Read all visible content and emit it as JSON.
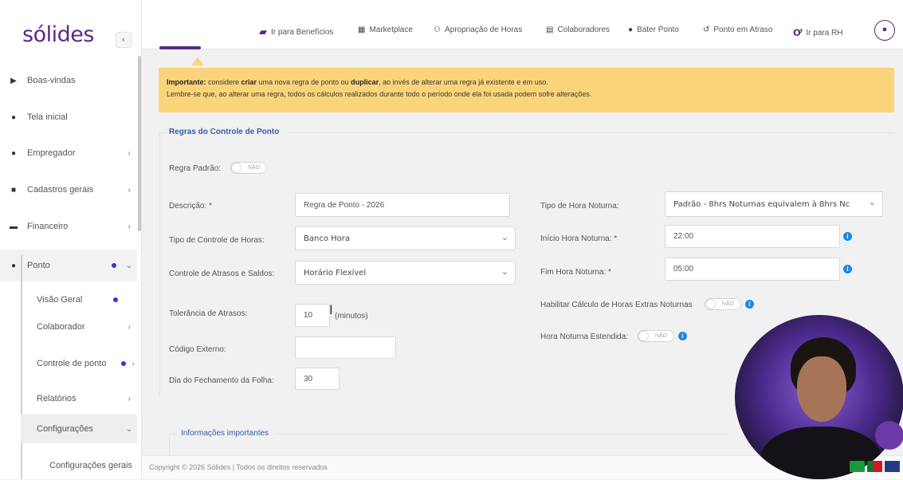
{
  "brand": {
    "logo": "sólides",
    "collapse_icon": "chevron-left-icon"
  },
  "sidebar": {
    "items": [
      {
        "label": "Boas-vindas",
        "icon": "play-icon",
        "glyph": "▶"
      },
      {
        "label": "Tela inicial",
        "icon": "info-icon",
        "glyph": "●"
      },
      {
        "label": "Empregador",
        "icon": "user-circle-icon",
        "glyph": "●",
        "chevron": "›"
      },
      {
        "label": "Cadastros gerais",
        "icon": "plus-square-icon",
        "glyph": "■",
        "chevron": "›"
      },
      {
        "label": "Financeiro",
        "icon": "money-icon",
        "glyph": "▬",
        "chevron": "›"
      },
      {
        "label": "Ponto",
        "icon": "clock-icon",
        "glyph": "●",
        "chevron": "⌄"
      }
    ],
    "sub_items": [
      {
        "label": "Visão Geral"
      },
      {
        "label": "Colaborador",
        "chevron": "›"
      },
      {
        "label": "Controle de ponto",
        "chevron": "›"
      },
      {
        "label": "Relatórios",
        "chevron": "›"
      },
      {
        "label": "Configurações",
        "chevron": "⌄"
      },
      {
        "label": "Configurações gerais"
      }
    ]
  },
  "topbar": {
    "items": [
      {
        "label": "Ir para Benefícios",
        "icon": "megaphone-icon",
        "glyph": "▰"
      },
      {
        "label": "Marketplace",
        "icon": "cart-icon",
        "glyph": "▦"
      },
      {
        "label": "Apropriação de Horas",
        "icon": "users-icon",
        "glyph": "⚇"
      },
      {
        "label": "Colaboradores",
        "icon": "id-card-icon",
        "glyph": "▤"
      },
      {
        "label": "Bater Ponto",
        "icon": "clock-icon",
        "glyph": "●"
      },
      {
        "label": "Ponto em Atraso",
        "icon": "history-icon",
        "glyph": "↺"
      },
      {
        "label": "Ir para RH",
        "icon": "solides-rh-icon",
        "glyph": "ơ"
      }
    ],
    "avatar_glyph": "👤"
  },
  "alert": {
    "bold1": "Importante:",
    "t1": " considere ",
    "bold2": "criar",
    "t2": " uma nova regra de ponto ou ",
    "bold3": "duplicar",
    "t3": ", ao invés de alterar uma regra já existente e em uso.",
    "line2": "Lembre-se que, ao alterar uma regra, todos os cálculos realizados durante todo o período onde ela foi usada podem sofre alterações."
  },
  "form": {
    "section_title": "Regras do Controle de Ponto",
    "regra_padrao_label": "Regra Padrão:",
    "toggle_no": "NÃO",
    "descricao_label": "Descrição: *",
    "descricao_value": "Regra de Ponto - 2026",
    "tipo_controle_label": "Tipo de Controle de Horas:",
    "tipo_controle_value": "Banco Hora",
    "controle_atrasos_label": "Controle de Atrasos e Saldos:",
    "controle_atrasos_value": "Horário Flexível",
    "tolerancia_label": "Tolerância de Atrasos:",
    "tolerancia_value": "10",
    "tolerancia_unit": "(minutos)",
    "codigo_externo_label": "Código Externo:",
    "codigo_externo_value": "",
    "dia_fechamento_label": "Dia do Fechamento da Folha:",
    "dia_fechamento_value": "30",
    "tipo_hora_noturna_label": "Tipo de Hora Noturna:",
    "tipo_hora_noturna_value": "Padrão - 8hrs Noturnas equivalem à 8hrs Nc",
    "inicio_label": "Início Hora Noturna: *",
    "inicio_value": "22:00",
    "fim_label": "Fim Hora Noturna: *",
    "fim_value": "05:00",
    "habilitar_label": "Habilitar Cálculo de Horas Extras Noturnas",
    "estendida_label": "Hora Noturna Estendida:"
  },
  "info_section": {
    "title": "Informações importantes"
  },
  "footer": {
    "text": "Copyright © 2026 Sólides | Todos os direitos reservados"
  },
  "colors": {
    "brand": "#5b2a86",
    "alert_bg": "#f9d47b",
    "link_blue": "#2f5fa6",
    "info_blue": "#1e88e5"
  }
}
